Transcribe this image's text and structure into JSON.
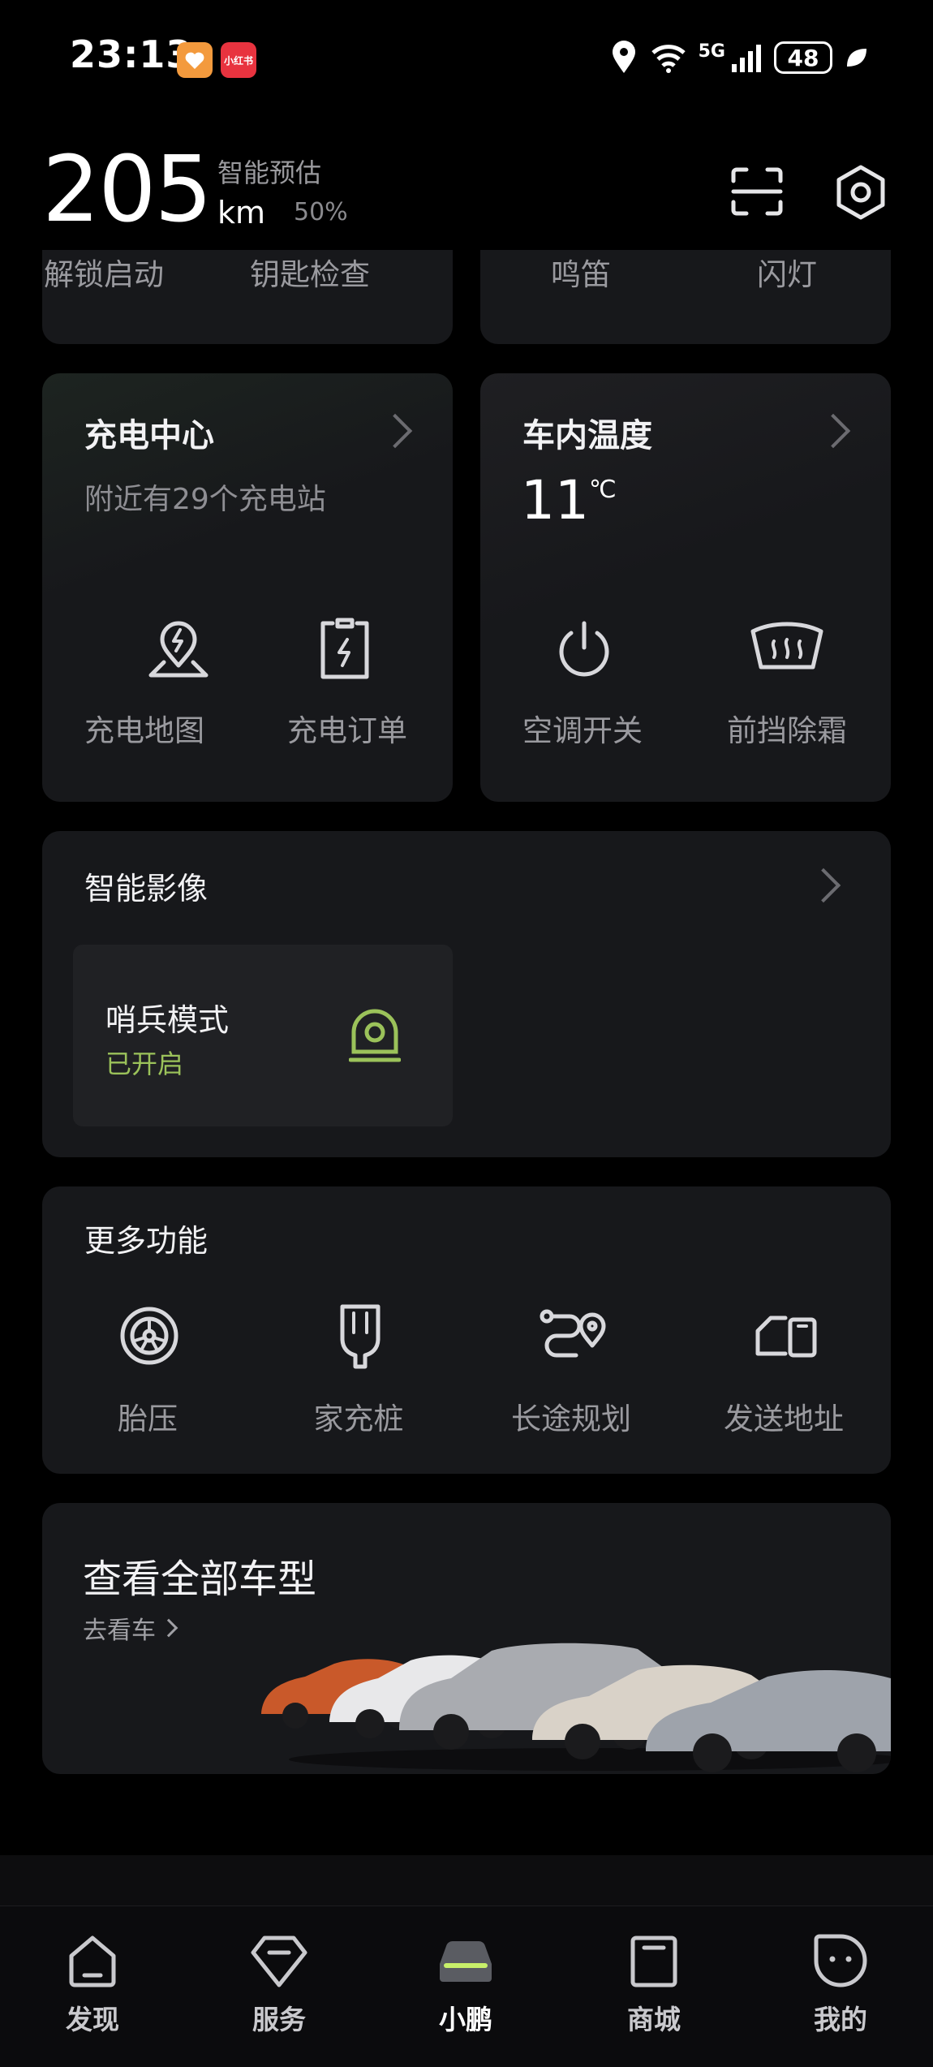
{
  "status_bar": {
    "time": "23:13",
    "app_badge_2": "小红书",
    "network": "5G",
    "battery": "48"
  },
  "header": {
    "range_value": "205",
    "range_unit": "km",
    "estimate_label": "智能预估",
    "battery_percent": "50%"
  },
  "quick_actions": {
    "left": [
      "解锁启动",
      "钥匙检查"
    ],
    "right": [
      "鸣笛",
      "闪灯"
    ]
  },
  "charging": {
    "title": "充电中心",
    "subtitle": "附近有29个充电站",
    "actions": [
      "充电地图",
      "充电订单"
    ]
  },
  "climate": {
    "title": "车内温度",
    "temperature": "11",
    "unit": "℃",
    "actions": [
      "空调开关",
      "前挡除霜"
    ]
  },
  "smart_video": {
    "title": "智能影像",
    "sentry": {
      "label": "哨兵模式",
      "status": "已开启"
    }
  },
  "more": {
    "title": "更多功能",
    "items": [
      "胎压",
      "家充桩",
      "长途规划",
      "发送地址"
    ]
  },
  "models": {
    "title": "查看全部车型",
    "link": "去看车"
  },
  "tabs": [
    "发现",
    "服务",
    "小鹏",
    "商城",
    "我的"
  ],
  "colors": {
    "accent_green": "#9bc25a",
    "card_bg": "#17181b"
  }
}
